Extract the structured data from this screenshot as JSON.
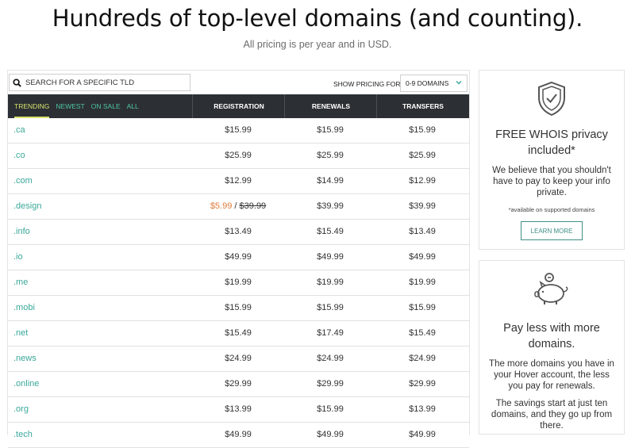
{
  "header": {
    "title": "Hundreds of top-level domains (and counting).",
    "subtitle": "All pricing is per year and in USD."
  },
  "search": {
    "placeholder": "SEARCH FOR A SPECIFIC TLD"
  },
  "pricing": {
    "label": "SHOW PRICING FOR",
    "selected": "0-9 DOMAINS"
  },
  "tabs": [
    "TRENDING",
    "NEWEST",
    "ON SALE",
    "ALL"
  ],
  "columns": [
    "REGISTRATION",
    "RENEWALS",
    "TRANSFERS"
  ],
  "rows": [
    {
      "tld": ".ca",
      "registration": "$15.99",
      "renewal": "$15.99",
      "transfer": "$15.99"
    },
    {
      "tld": ".co",
      "registration": "$25.99",
      "renewal": "$25.99",
      "transfer": "$25.99"
    },
    {
      "tld": ".com",
      "registration": "$12.99",
      "renewal": "$14.99",
      "transfer": "$12.99"
    },
    {
      "tld": ".design",
      "sale_price": "$5.99",
      "sale_sep": "/",
      "original_price": "$39.99",
      "renewal": "$39.99",
      "transfer": "$39.99"
    },
    {
      "tld": ".info",
      "registration": "$13.49",
      "renewal": "$15.49",
      "transfer": "$13.49"
    },
    {
      "tld": ".io",
      "registration": "$49.99",
      "renewal": "$49.99",
      "transfer": "$49.99"
    },
    {
      "tld": ".me",
      "registration": "$19.99",
      "renewal": "$19.99",
      "transfer": "$19.99"
    },
    {
      "tld": ".mobi",
      "registration": "$15.99",
      "renewal": "$15.99",
      "transfer": "$15.99"
    },
    {
      "tld": ".net",
      "registration": "$15.49",
      "renewal": "$17.49",
      "transfer": "$15.49"
    },
    {
      "tld": ".news",
      "registration": "$24.99",
      "renewal": "$24.99",
      "transfer": "$24.99"
    },
    {
      "tld": ".online",
      "registration": "$29.99",
      "renewal": "$29.99",
      "transfer": "$29.99"
    },
    {
      "tld": ".org",
      "registration": "$13.99",
      "renewal": "$15.99",
      "transfer": "$13.99"
    },
    {
      "tld": ".tech",
      "registration": "$49.99",
      "renewal": "$49.99",
      "transfer": "$49.99"
    }
  ],
  "whois_card": {
    "icon": "shield-check-icon",
    "title": "FREE WHOIS privacy included*",
    "text": "We believe that you shouldn't have to pay to keep your info private.",
    "note": "*available on supported domains",
    "button": "LEARN MORE"
  },
  "savings_card": {
    "icon": "piggy-bank-icon",
    "title": "Pay less with more domains.",
    "text1": "The more domains you have in your Hover account, the less you pay for renewals.",
    "text2": "The savings start at just ten domains, and they go up from there."
  },
  "colors": {
    "header_bg": "#2c3034",
    "tab_active": "#d8e26c",
    "tab_link": "#4fc4a5",
    "tld_link": "#3aa89a",
    "sale": "#e07a3c",
    "button_border": "#3f8f86"
  }
}
